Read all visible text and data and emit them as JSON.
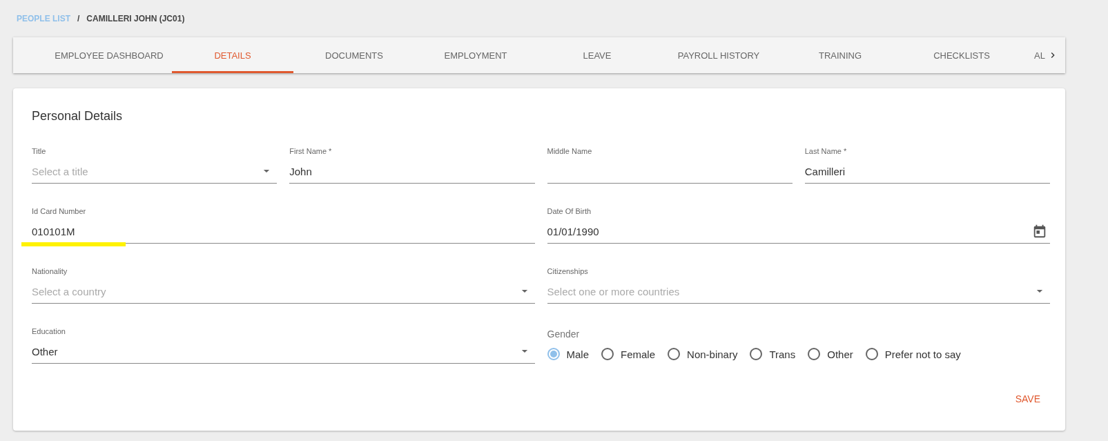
{
  "breadcrumb": [
    {
      "label": "PEOPLE LIST",
      "link": true
    },
    {
      "label": "/",
      "link": false
    },
    {
      "label": "CAMILLERI JOHN (JC01)",
      "link": false
    }
  ],
  "tabs": [
    {
      "label": "EMPLOYEE DASHBOARD",
      "selected": false
    },
    {
      "label": "DETAILS",
      "selected": true
    },
    {
      "label": "DOCUMENTS",
      "selected": false
    },
    {
      "label": "EMPLOYMENT",
      "selected": false
    },
    {
      "label": "LEAVE",
      "selected": false
    },
    {
      "label": "PAYROLL HISTORY",
      "selected": false
    },
    {
      "label": "TRAINING",
      "selected": false
    },
    {
      "label": "CHECKLISTS",
      "selected": false
    },
    {
      "label": "AL",
      "selected": false
    }
  ],
  "card": {
    "title": "Personal Details",
    "rows": [
      [
        {
          "kind": "select",
          "label": "Title",
          "placeholder": "Select a title"
        },
        {
          "kind": "text",
          "label": "First Name *",
          "value": "John"
        },
        {
          "kind": "text",
          "label": "Middle Name"
        },
        {
          "kind": "text",
          "label": "Last Name *",
          "value": "Camilleri"
        }
      ],
      [
        {
          "kind": "text",
          "label": "Id Card Number",
          "value": "010101M",
          "highlighted": true
        },
        {
          "kind": "date",
          "label": "Date Of Birth",
          "value": "01/01/1990"
        }
      ],
      [
        {
          "kind": "select",
          "label": "Nationality",
          "placeholder": "Select a country"
        },
        {
          "kind": "select",
          "label": "Citizenships",
          "placeholder": "Select one or more countries"
        }
      ],
      [
        {
          "kind": "select",
          "label": "Education",
          "value": "Other"
        },
        {
          "kind": "radio",
          "label": "Gender",
          "options": [
            {
              "label": "Male",
              "selected": true
            },
            {
              "label": "Female",
              "selected": false
            },
            {
              "label": "Non-binary",
              "selected": false
            },
            {
              "label": "Trans",
              "selected": false
            },
            {
              "label": "Other",
              "selected": false
            },
            {
              "label": "Prefer not to say",
              "selected": false
            }
          ]
        }
      ]
    ],
    "save_button": "SAVE"
  }
}
